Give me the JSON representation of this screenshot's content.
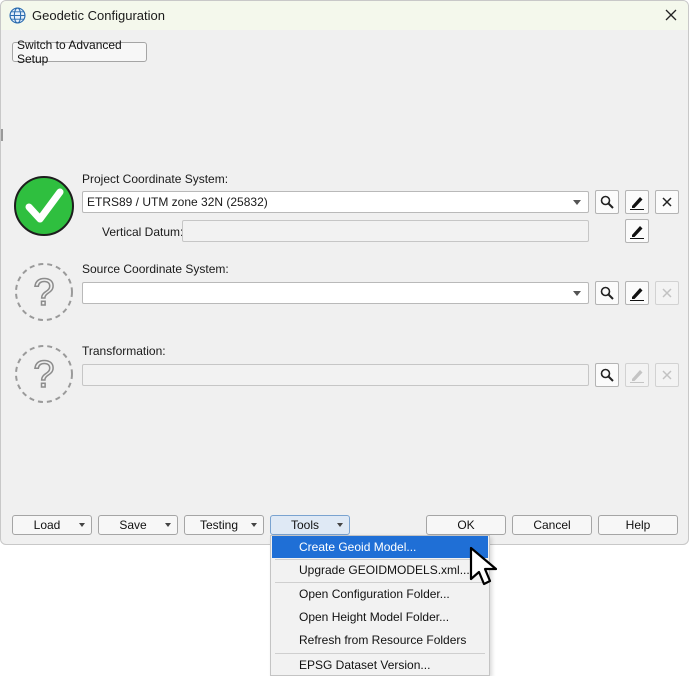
{
  "window": {
    "title": "Geodetic Configuration",
    "icons": {
      "app": "globe-icon",
      "close": "close-icon"
    }
  },
  "top": {
    "advanced_button": "Switch to Advanced Setup"
  },
  "project": {
    "label": "Project Coordinate System:",
    "value": "ETRS89 / UTM zone 32N (25832)",
    "vertical_label": "Vertical Datum:",
    "vertical_value": "",
    "status": "valid-check-icon"
  },
  "source": {
    "label": "Source Coordinate System:",
    "value": "",
    "status": "unknown-question-icon"
  },
  "transformation": {
    "label": "Transformation:",
    "value": "",
    "status": "unknown-question-icon"
  },
  "footer": {
    "load": "Load",
    "save": "Save",
    "testing": "Testing",
    "tools": "Tools",
    "ok": "OK",
    "cancel": "Cancel",
    "help": "Help"
  },
  "tools_menu": {
    "items": [
      "Create Geoid Model...",
      "Upgrade GEOIDMODELS.xml...",
      "Open Configuration Folder...",
      "Open Height Model Folder...",
      "Refresh from Resource Folders",
      "EPSG Dataset Version..."
    ],
    "highlighted_index": 0
  },
  "colors": {
    "check_green": "#2fbf3f",
    "menu_highlight": "#1f6fd6",
    "titlebar": "#f4f8ec"
  }
}
